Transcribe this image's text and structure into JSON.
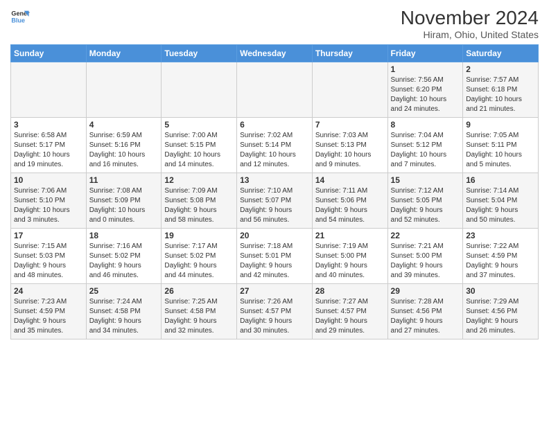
{
  "logo": {
    "line1": "General",
    "line2": "Blue"
  },
  "title": "November 2024",
  "location": "Hiram, Ohio, United States",
  "weekdays": [
    "Sunday",
    "Monday",
    "Tuesday",
    "Wednesday",
    "Thursday",
    "Friday",
    "Saturday"
  ],
  "weeks": [
    [
      {
        "day": "",
        "info": ""
      },
      {
        "day": "",
        "info": ""
      },
      {
        "day": "",
        "info": ""
      },
      {
        "day": "",
        "info": ""
      },
      {
        "day": "",
        "info": ""
      },
      {
        "day": "1",
        "info": "Sunrise: 7:56 AM\nSunset: 6:20 PM\nDaylight: 10 hours\nand 24 minutes."
      },
      {
        "day": "2",
        "info": "Sunrise: 7:57 AM\nSunset: 6:18 PM\nDaylight: 10 hours\nand 21 minutes."
      }
    ],
    [
      {
        "day": "3",
        "info": "Sunrise: 6:58 AM\nSunset: 5:17 PM\nDaylight: 10 hours\nand 19 minutes."
      },
      {
        "day": "4",
        "info": "Sunrise: 6:59 AM\nSunset: 5:16 PM\nDaylight: 10 hours\nand 16 minutes."
      },
      {
        "day": "5",
        "info": "Sunrise: 7:00 AM\nSunset: 5:15 PM\nDaylight: 10 hours\nand 14 minutes."
      },
      {
        "day": "6",
        "info": "Sunrise: 7:02 AM\nSunset: 5:14 PM\nDaylight: 10 hours\nand 12 minutes."
      },
      {
        "day": "7",
        "info": "Sunrise: 7:03 AM\nSunset: 5:13 PM\nDaylight: 10 hours\nand 9 minutes."
      },
      {
        "day": "8",
        "info": "Sunrise: 7:04 AM\nSunset: 5:12 PM\nDaylight: 10 hours\nand 7 minutes."
      },
      {
        "day": "9",
        "info": "Sunrise: 7:05 AM\nSunset: 5:11 PM\nDaylight: 10 hours\nand 5 minutes."
      }
    ],
    [
      {
        "day": "10",
        "info": "Sunrise: 7:06 AM\nSunset: 5:10 PM\nDaylight: 10 hours\nand 3 minutes."
      },
      {
        "day": "11",
        "info": "Sunrise: 7:08 AM\nSunset: 5:09 PM\nDaylight: 10 hours\nand 0 minutes."
      },
      {
        "day": "12",
        "info": "Sunrise: 7:09 AM\nSunset: 5:08 PM\nDaylight: 9 hours\nand 58 minutes."
      },
      {
        "day": "13",
        "info": "Sunrise: 7:10 AM\nSunset: 5:07 PM\nDaylight: 9 hours\nand 56 minutes."
      },
      {
        "day": "14",
        "info": "Sunrise: 7:11 AM\nSunset: 5:06 PM\nDaylight: 9 hours\nand 54 minutes."
      },
      {
        "day": "15",
        "info": "Sunrise: 7:12 AM\nSunset: 5:05 PM\nDaylight: 9 hours\nand 52 minutes."
      },
      {
        "day": "16",
        "info": "Sunrise: 7:14 AM\nSunset: 5:04 PM\nDaylight: 9 hours\nand 50 minutes."
      }
    ],
    [
      {
        "day": "17",
        "info": "Sunrise: 7:15 AM\nSunset: 5:03 PM\nDaylight: 9 hours\nand 48 minutes."
      },
      {
        "day": "18",
        "info": "Sunrise: 7:16 AM\nSunset: 5:02 PM\nDaylight: 9 hours\nand 46 minutes."
      },
      {
        "day": "19",
        "info": "Sunrise: 7:17 AM\nSunset: 5:02 PM\nDaylight: 9 hours\nand 44 minutes."
      },
      {
        "day": "20",
        "info": "Sunrise: 7:18 AM\nSunset: 5:01 PM\nDaylight: 9 hours\nand 42 minutes."
      },
      {
        "day": "21",
        "info": "Sunrise: 7:19 AM\nSunset: 5:00 PM\nDaylight: 9 hours\nand 40 minutes."
      },
      {
        "day": "22",
        "info": "Sunrise: 7:21 AM\nSunset: 5:00 PM\nDaylight: 9 hours\nand 39 minutes."
      },
      {
        "day": "23",
        "info": "Sunrise: 7:22 AM\nSunset: 4:59 PM\nDaylight: 9 hours\nand 37 minutes."
      }
    ],
    [
      {
        "day": "24",
        "info": "Sunrise: 7:23 AM\nSunset: 4:59 PM\nDaylight: 9 hours\nand 35 minutes."
      },
      {
        "day": "25",
        "info": "Sunrise: 7:24 AM\nSunset: 4:58 PM\nDaylight: 9 hours\nand 34 minutes."
      },
      {
        "day": "26",
        "info": "Sunrise: 7:25 AM\nSunset: 4:58 PM\nDaylight: 9 hours\nand 32 minutes."
      },
      {
        "day": "27",
        "info": "Sunrise: 7:26 AM\nSunset: 4:57 PM\nDaylight: 9 hours\nand 30 minutes."
      },
      {
        "day": "28",
        "info": "Sunrise: 7:27 AM\nSunset: 4:57 PM\nDaylight: 9 hours\nand 29 minutes."
      },
      {
        "day": "29",
        "info": "Sunrise: 7:28 AM\nSunset: 4:56 PM\nDaylight: 9 hours\nand 27 minutes."
      },
      {
        "day": "30",
        "info": "Sunrise: 7:29 AM\nSunset: 4:56 PM\nDaylight: 9 hours\nand 26 minutes."
      }
    ]
  ]
}
